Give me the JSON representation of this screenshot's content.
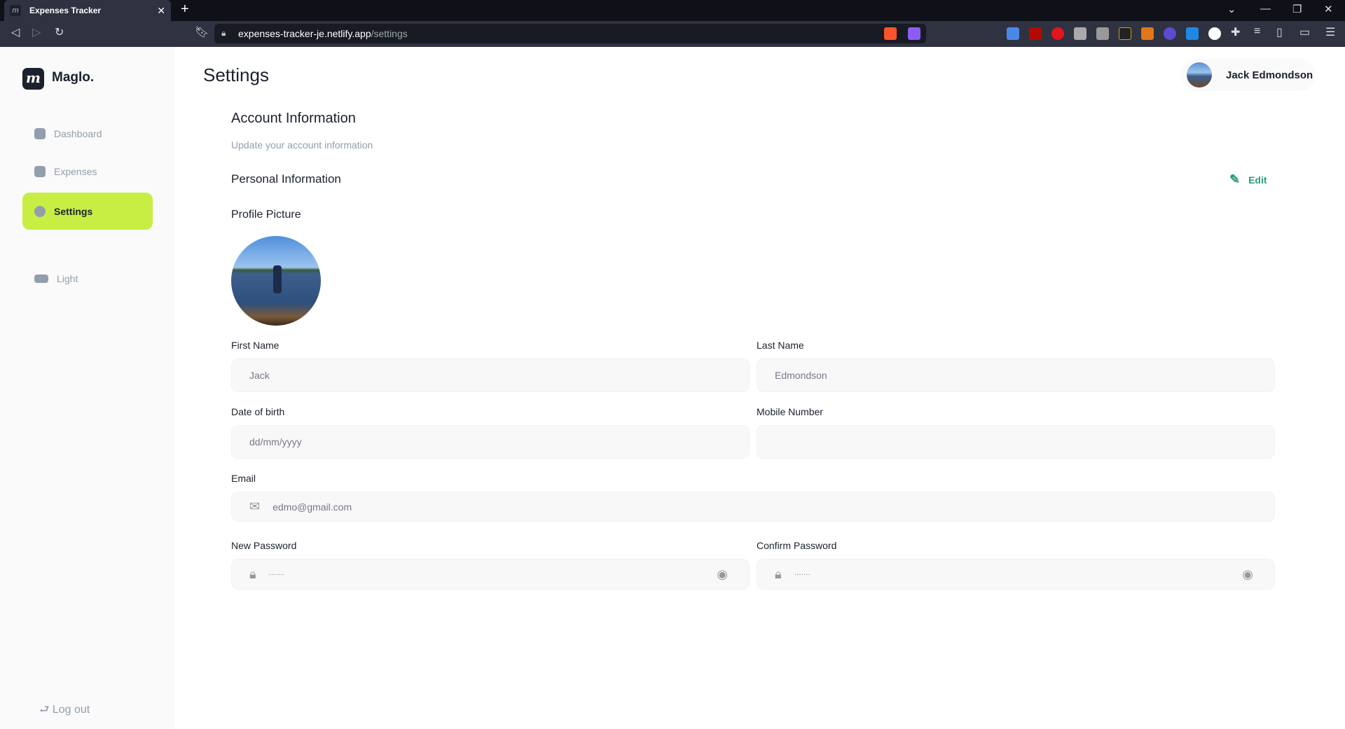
{
  "browser": {
    "tab_title": "Expenses Tracker",
    "url_host": "expenses-tracker-je.netlify.app",
    "url_path": "/settings"
  },
  "sidebar": {
    "brand": "Maglo.",
    "items": [
      {
        "label": "Dashboard",
        "icon": "home-icon"
      },
      {
        "label": "Expenses",
        "icon": "chart-icon"
      },
      {
        "label": "Settings",
        "icon": "gear-icon",
        "active": true
      }
    ],
    "theme_toggle": "Light",
    "logout": "Log out",
    "accent": "#c8ee44"
  },
  "header": {
    "title": "Settings",
    "user_name": "Jack Edmondson"
  },
  "account": {
    "title": "Account Information",
    "subtitle": "Update your account information",
    "personal_title": "Personal Information",
    "edit_label": "Edit",
    "profile_picture_label": "Profile Picture"
  },
  "form": {
    "first_name": {
      "label": "First Name",
      "value": "Jack"
    },
    "last_name": {
      "label": "Last Name",
      "value": "Edmondson"
    },
    "dob": {
      "label": "Date of birth",
      "placeholder": "dd/mm/yyyy"
    },
    "mobile": {
      "label": "Mobile Number",
      "value": ""
    },
    "email": {
      "label": "Email",
      "value": "edmo@gmail.com"
    },
    "new_password": {
      "label": "New Password",
      "value": "·······"
    },
    "confirm_password": {
      "label": "Confirm Password",
      "value": "·······"
    }
  }
}
